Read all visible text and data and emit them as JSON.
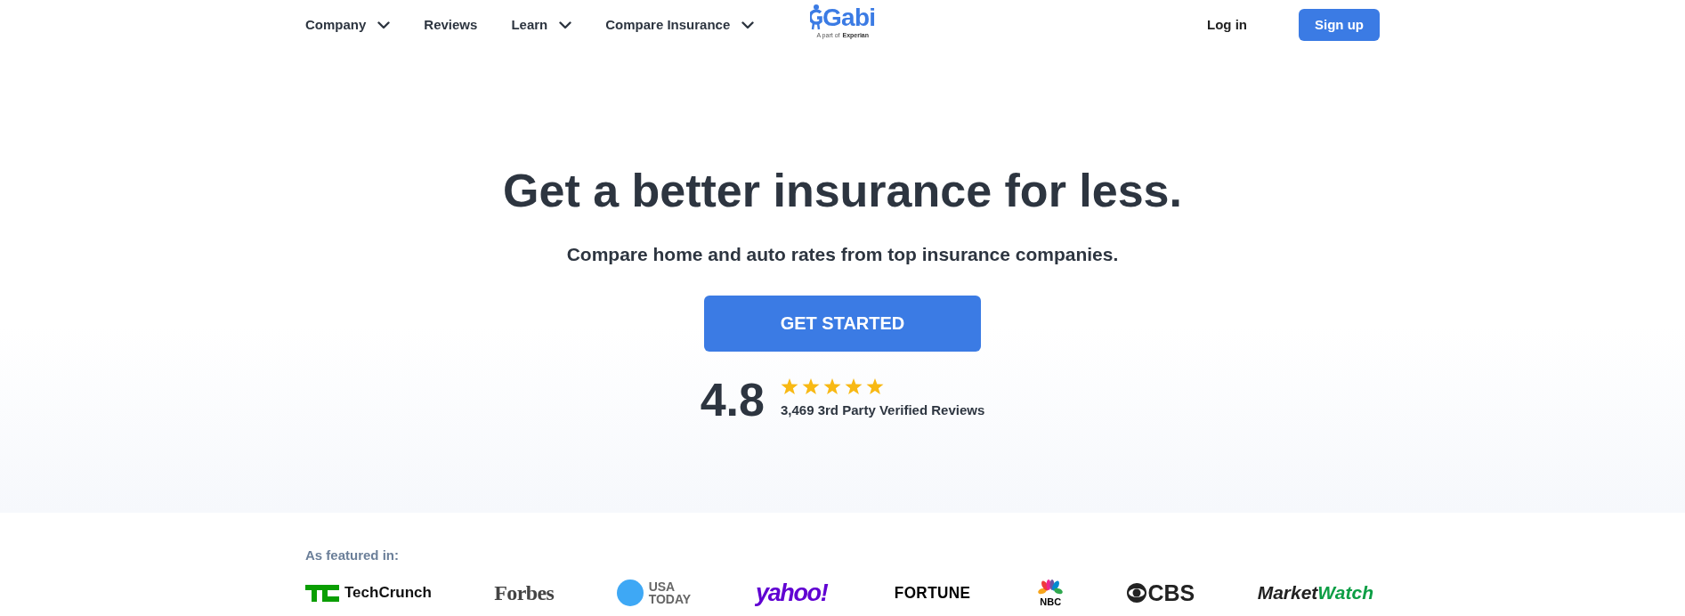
{
  "nav": {
    "items": [
      {
        "label": "Company",
        "dropdown": true
      },
      {
        "label": "Reviews",
        "dropdown": false
      },
      {
        "label": "Learn",
        "dropdown": true
      },
      {
        "label": "Compare Insurance",
        "dropdown": true
      }
    ],
    "logo": {
      "name": "Gabi",
      "tagline": "A part of",
      "partner": "Experian"
    },
    "login": "Log in",
    "signup": "Sign up"
  },
  "hero": {
    "title": "Get a better insurance for less.",
    "subtitle": "Compare home and auto rates from top insurance companies.",
    "cta": "GET STARTED",
    "rating": {
      "score": "4.8",
      "stars": 5,
      "reviews": "3,469 3rd Party Verified Reviews"
    }
  },
  "featured": {
    "heading": "As featured in:",
    "logos": [
      {
        "kind": "techcrunch",
        "text": "TechCrunch"
      },
      {
        "kind": "forbes",
        "text": "Forbes"
      },
      {
        "kind": "usatoday",
        "text": "USA TODAY"
      },
      {
        "kind": "yahoo",
        "text": "yahoo!"
      },
      {
        "kind": "fortune",
        "text": "FORTUNE"
      },
      {
        "kind": "nbc",
        "text": "NBC"
      },
      {
        "kind": "cbs",
        "text": "CBS"
      },
      {
        "kind": "marketwatch",
        "text": "Market",
        "text2": "Watch"
      }
    ]
  }
}
